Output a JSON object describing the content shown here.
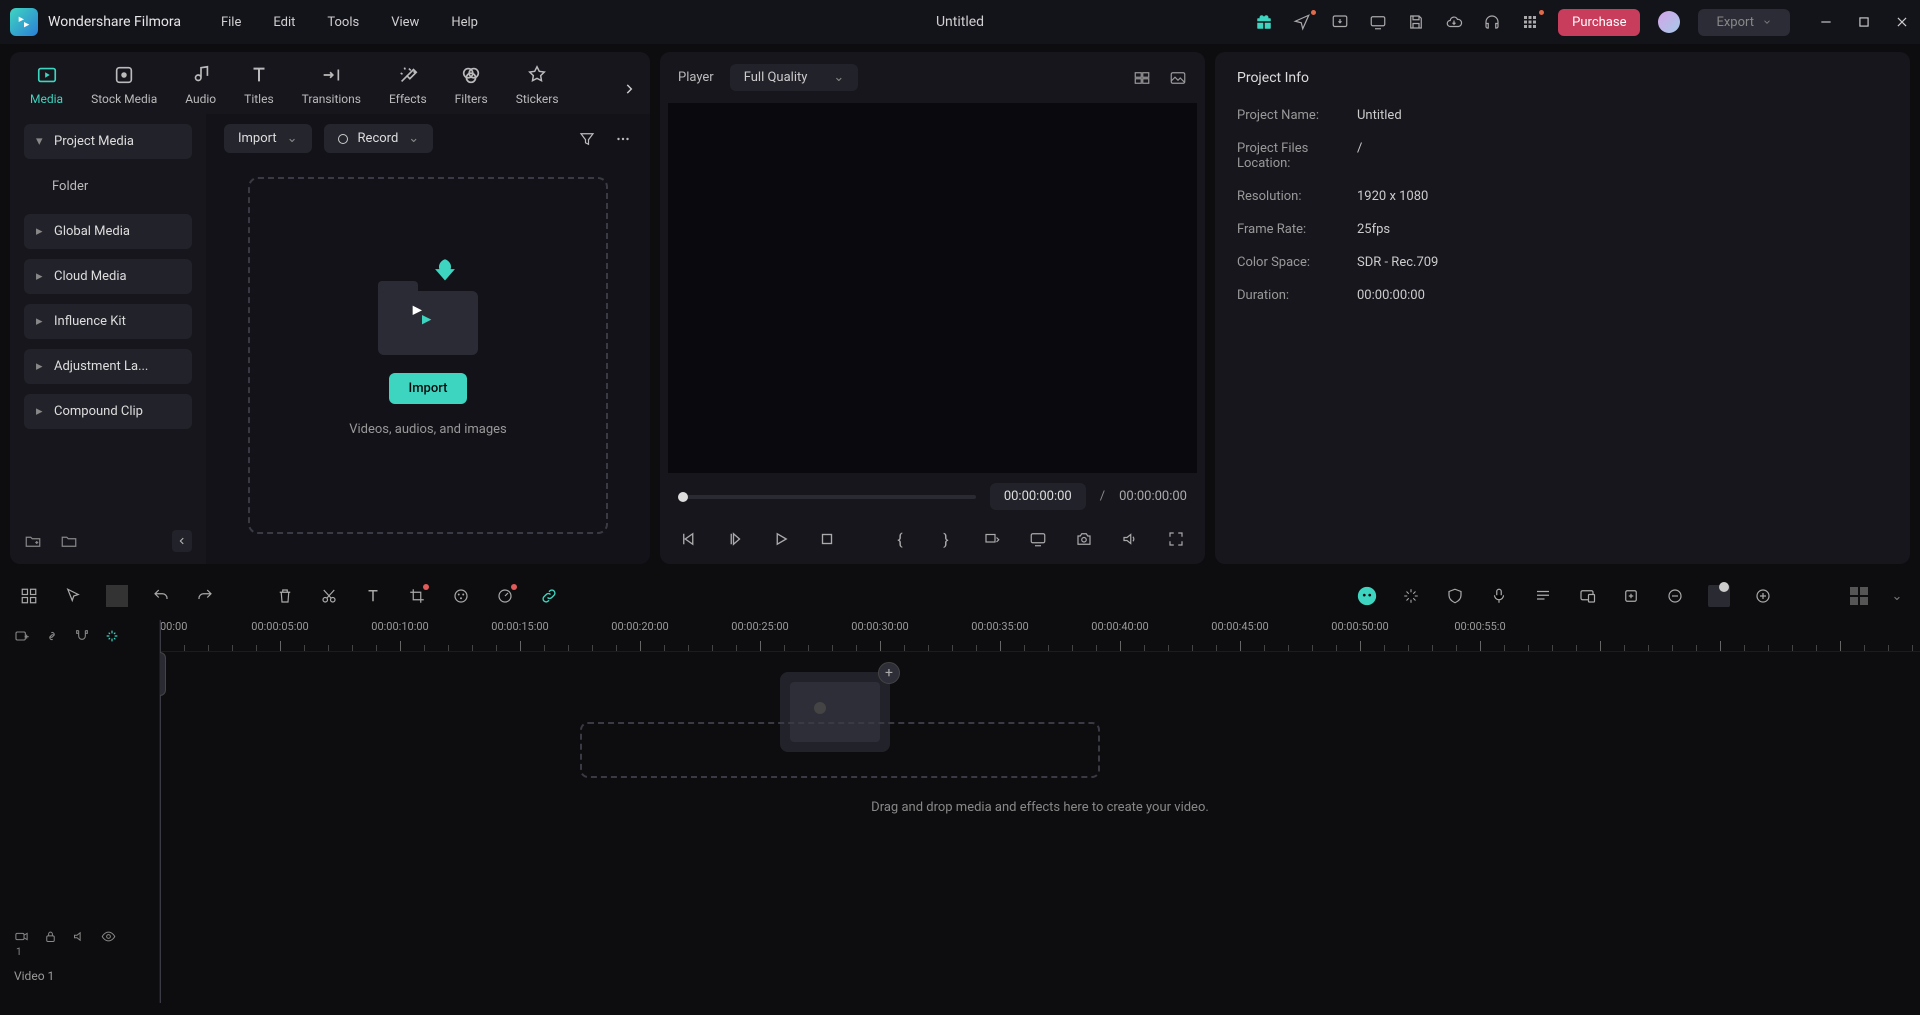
{
  "app": {
    "name": "Wondershare Filmora",
    "document_title": "Untitled"
  },
  "menubar": [
    "File",
    "Edit",
    "Tools",
    "View",
    "Help"
  ],
  "titlebar": {
    "purchase": "Purchase",
    "export": "Export"
  },
  "tabs": [
    {
      "label": "Media",
      "active": true
    },
    {
      "label": "Stock Media"
    },
    {
      "label": "Audio"
    },
    {
      "label": "Titles"
    },
    {
      "label": "Transitions"
    },
    {
      "label": "Effects"
    },
    {
      "label": "Filters"
    },
    {
      "label": "Stickers"
    }
  ],
  "media_toolbar": {
    "import": "Import",
    "record": "Record"
  },
  "media_sidebar": {
    "items": [
      {
        "label": "Project Media",
        "expanded": true
      },
      {
        "label": "Folder",
        "sub": true
      },
      {
        "label": "Global Media"
      },
      {
        "label": "Cloud Media"
      },
      {
        "label": "Influence Kit"
      },
      {
        "label": "Adjustment La..."
      },
      {
        "label": "Compound Clip"
      }
    ]
  },
  "dropzone": {
    "button": "Import",
    "hint": "Videos, audios, and images"
  },
  "preview": {
    "label": "Player",
    "quality": "Full Quality",
    "time_current": "00:00:00:00",
    "time_separator": "/",
    "time_total": "00:00:00:00"
  },
  "info": {
    "title": "Project Info",
    "rows": [
      {
        "label": "Project Name:",
        "value": "Untitled"
      },
      {
        "label": "Project Files Location:",
        "value": "/"
      },
      {
        "label": "Resolution:",
        "value": "1920 x 1080"
      },
      {
        "label": "Frame Rate:",
        "value": "25fps"
      },
      {
        "label": "Color Space:",
        "value": "SDR - Rec.709"
      },
      {
        "label": "Duration:",
        "value": "00:00:00:00"
      }
    ]
  },
  "timeline": {
    "track_label": "Video 1",
    "hint": "Drag and drop media and effects here to create your video.",
    "ruler_start": "00:00",
    "ruler_labels": [
      "00:00:05:00",
      "00:00:10:00",
      "00:00:15:00",
      "00:00:20:00",
      "00:00:25:00",
      "00:00:30:00",
      "00:00:35:00",
      "00:00:40:00",
      "00:00:45:00",
      "00:00:50:00",
      "00:00:55:0"
    ]
  }
}
